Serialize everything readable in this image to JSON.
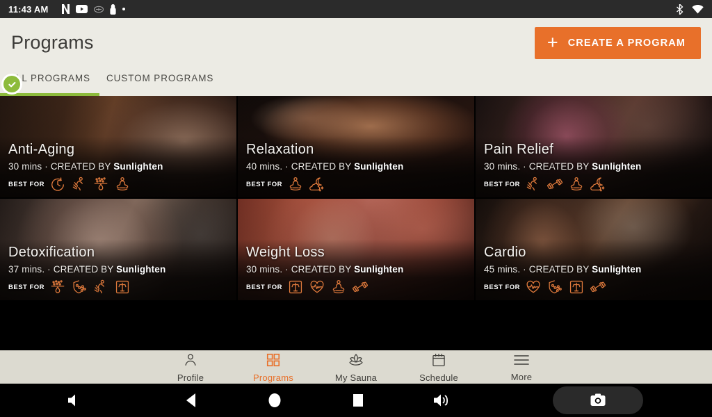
{
  "statusbar": {
    "time": "11:43 AM",
    "notification_icons": [
      "netflix-icon",
      "youtube-icon",
      "nfl-icon",
      "app-icon",
      "dot-icon"
    ],
    "system_icons": [
      "bluetooth-icon",
      "wifi-icon"
    ]
  },
  "header": {
    "title": "Programs",
    "create_button": {
      "label": "CREATE A PROGRAM",
      "icon": "plus-icon",
      "color": "#e8702a"
    },
    "tabs": [
      {
        "label": "ALL PROGRAMS",
        "active": true,
        "underline_color": "#8dbb3c",
        "badge_icon": "check-circle-icon"
      },
      {
        "label": "CUSTOM PROGRAMS",
        "active": false
      }
    ]
  },
  "programs": {
    "best_for_label": "BEST FOR",
    "cards": [
      {
        "title": "Anti-Aging",
        "duration": "30 mins",
        "created_by_prefix": "CREATED BY",
        "author": "Sunlighten",
        "photo": "ph-antiaging",
        "benefits": [
          "anti-aging-clock-icon",
          "muscle-recovery-icon",
          "detox-droplet-icon",
          "relaxation-lotus-icon"
        ]
      },
      {
        "title": "Relaxation",
        "duration": "40 mins.",
        "created_by_prefix": "CREATED BY",
        "author": "Sunlighten",
        "photo": "ph-relaxation",
        "benefits": [
          "relaxation-lotus-icon",
          "sleep-moon-icon"
        ]
      },
      {
        "title": "Pain Relief",
        "duration": "30 mins.",
        "created_by_prefix": "CREATED BY",
        "author": "Sunlighten",
        "photo": "ph-painrelief",
        "benefits": [
          "muscle-recovery-icon",
          "dumbbell-icon",
          "relaxation-lotus-icon",
          "sleep-moon-icon"
        ]
      },
      {
        "title": "Detoxification",
        "duration": "37 mins.",
        "created_by_prefix": "CREATED BY",
        "author": "Sunlighten",
        "photo": "ph-detox",
        "benefits": [
          "detox-droplet-icon",
          "immunity-shield-icon",
          "muscle-recovery-icon",
          "weight-scale-icon"
        ]
      },
      {
        "title": "Weight Loss",
        "duration": "30 mins.",
        "created_by_prefix": "CREATED BY",
        "author": "Sunlighten",
        "photo": "ph-weightloss",
        "benefits": [
          "weight-scale-icon",
          "heart-rate-icon",
          "relaxation-lotus-icon",
          "dumbbell-icon"
        ]
      },
      {
        "title": "Cardio",
        "duration": "45 mins.",
        "created_by_prefix": "CREATED BY",
        "author": "Sunlighten",
        "photo": "ph-cardio",
        "benefits": [
          "heart-rate-icon",
          "immunity-shield-icon",
          "weight-scale-icon",
          "dumbbell-icon"
        ]
      }
    ]
  },
  "bottom_nav": {
    "active_color": "#e8702a",
    "items": [
      {
        "label": "Profile",
        "icon": "person-icon",
        "active": false
      },
      {
        "label": "Programs",
        "icon": "grid-icon",
        "active": true
      },
      {
        "label": "My Sauna",
        "icon": "lotus-icon",
        "active": false
      },
      {
        "label": "Schedule",
        "icon": "calendar-icon",
        "active": false
      },
      {
        "label": "More",
        "icon": "hamburger-icon",
        "active": false
      }
    ]
  },
  "android_nav": {
    "buttons": [
      "volume-down-icon",
      "back-icon",
      "home-icon",
      "recents-icon",
      "volume-up-icon",
      "screenshot-icon"
    ]
  }
}
